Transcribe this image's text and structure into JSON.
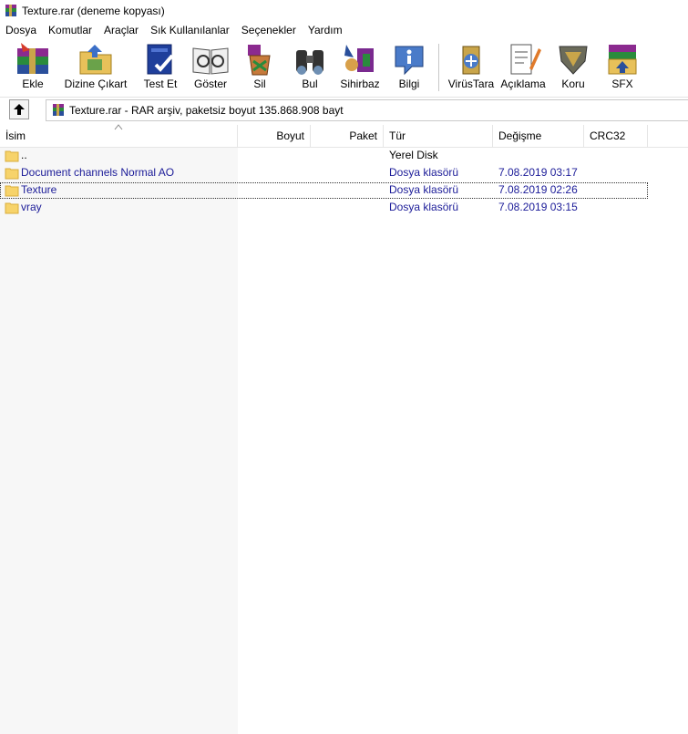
{
  "window": {
    "title": "Texture.rar (deneme kopyası)"
  },
  "menu": [
    "Dosya",
    "Komutlar",
    "Araçlar",
    "Sık Kullanılanlar",
    "Seçenekler",
    "Yardım"
  ],
  "toolbar": [
    {
      "label": "Ekle",
      "icon": "add-to-archive-icon"
    },
    {
      "label": "Dizine Çıkart",
      "icon": "extract-to-folder-icon"
    },
    {
      "label": "Test Et",
      "icon": "test-archive-icon"
    },
    {
      "label": "Göster",
      "icon": "view-file-icon"
    },
    {
      "label": "Sil",
      "icon": "delete-icon"
    },
    {
      "label": "Bul",
      "icon": "find-binoculars-icon"
    },
    {
      "label": "Sihirbaz",
      "icon": "wizard-icon"
    },
    {
      "label": "Bilgi",
      "icon": "info-icon"
    },
    {
      "label": "VirüsTara",
      "icon": "virus-scan-icon"
    },
    {
      "label": "Açıklama",
      "icon": "comment-icon"
    },
    {
      "label": "Koru",
      "icon": "protect-shield-icon"
    },
    {
      "label": "SFX",
      "icon": "sfx-icon"
    }
  ],
  "address": {
    "text": "Texture.rar - RAR arşiv, paketsiz boyut 135.868.908 bayt"
  },
  "columns": [
    "İsim",
    "Boyut",
    "Paket",
    "Tür",
    "Değişme",
    "CRC32"
  ],
  "files": [
    {
      "name": "..",
      "size": "",
      "packed": "",
      "type": "Yerel Disk",
      "modified": "",
      "crc": ""
    },
    {
      "name": "Document channels Normal AO",
      "size": "",
      "packed": "",
      "type": "Dosya klasörü",
      "modified": "7.08.2019 03:17",
      "crc": ""
    },
    {
      "name": "Texture",
      "size": "",
      "packed": "",
      "type": "Dosya klasörü",
      "modified": "7.08.2019 02:26",
      "crc": ""
    },
    {
      "name": "vray",
      "size": "",
      "packed": "",
      "type": "Dosya klasörü",
      "modified": "7.08.2019 03:15",
      "crc": ""
    }
  ],
  "colors": {
    "link_text": "#1b1b98",
    "folder": "#f7d36a"
  }
}
